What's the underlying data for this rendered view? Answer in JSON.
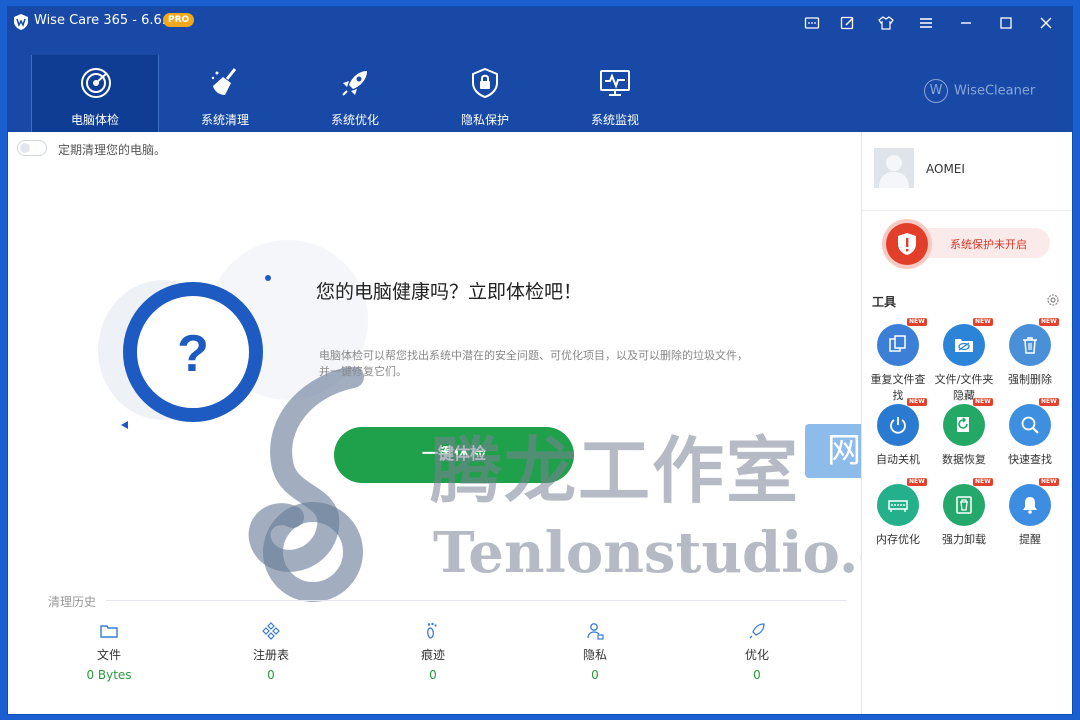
{
  "window": {
    "title": "Wise Care 365 - 6.6.3",
    "badge": "PRO",
    "brand": "WiseCleaner"
  },
  "nav": [
    {
      "label": "电脑体检",
      "icon": "radar-icon",
      "active": true
    },
    {
      "label": "系统清理",
      "icon": "broom-icon",
      "active": false
    },
    {
      "label": "系统优化",
      "icon": "rocket-icon",
      "active": false
    },
    {
      "label": "隐私保护",
      "icon": "lock-icon",
      "active": false
    },
    {
      "label": "系统监视",
      "icon": "monitor-icon",
      "active": false
    }
  ],
  "main": {
    "schedule_label": "定期清理您的电脑。",
    "headline": "您的电脑健康吗？立即体检吧！",
    "description": "电脑体检可以帮您找出系统中潜在的安全问题、可优化项目，以及可以删除的垃圾文件，并一键修复它们。",
    "scan_button": "一键体检",
    "history_title": "清理历史",
    "history": [
      {
        "label": "文件",
        "value": "0 Bytes",
        "icon": "folder-icon"
      },
      {
        "label": "注册表",
        "value": "0",
        "icon": "registry-icon"
      },
      {
        "label": "痕迹",
        "value": "0",
        "icon": "footprint-icon"
      },
      {
        "label": "隐私",
        "value": "0",
        "icon": "privacy-icon"
      },
      {
        "label": "优化",
        "value": "0",
        "icon": "rocket-small-icon"
      }
    ]
  },
  "sidebar": {
    "username": "AOMEI",
    "protection_status": "系统保护未开启",
    "tools_title": "工具",
    "new_badge": "NEW",
    "tools": [
      {
        "label": "重复文件查找",
        "color": "#3b7fd6"
      },
      {
        "label": "文件/文件夹隐藏",
        "color": "#2b84d8"
      },
      {
        "label": "强制删除",
        "color": "#4a90d9"
      },
      {
        "label": "自动关机",
        "color": "#2b7ad2"
      },
      {
        "label": "数据恢复",
        "color": "#23a866"
      },
      {
        "label": "快速查找",
        "color": "#3e8fe0"
      },
      {
        "label": "内存优化",
        "color": "#23b08a"
      },
      {
        "label": "强力卸载",
        "color": "#24a86c"
      },
      {
        "label": "提醒",
        "color": "#3d8ee2"
      }
    ]
  },
  "watermark": {
    "line1": "腾龙工作室",
    "badge": "网站",
    "line2": "Tenlonstudio.com"
  },
  "colors": {
    "header": "#1849a6",
    "accent": "#1d5bc2",
    "scan_button": "#1fa04a",
    "alert": "#e23f2a"
  }
}
